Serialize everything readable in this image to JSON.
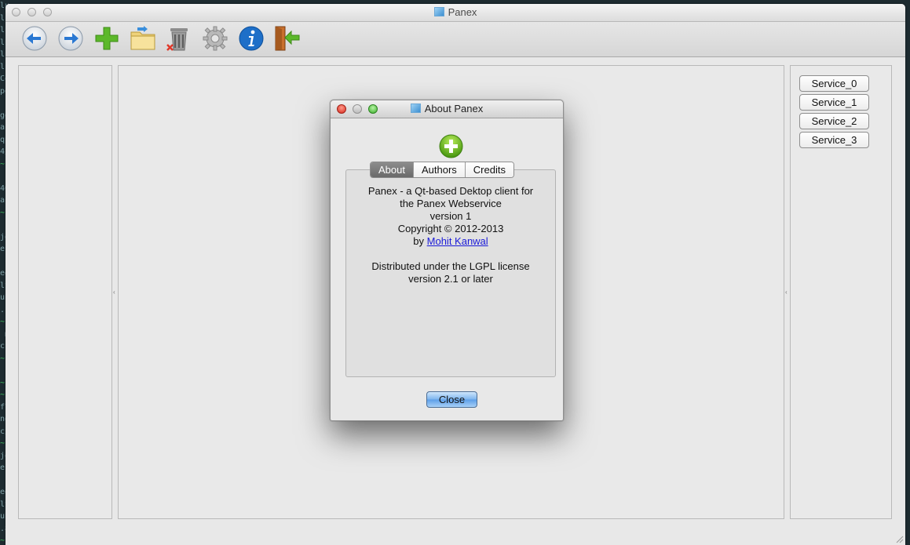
{
  "window": {
    "title": "Panex"
  },
  "toolbar": {
    "buttons": [
      {
        "name": "back-button",
        "icon": "arrow-left-icon"
      },
      {
        "name": "forward-button",
        "icon": "arrow-right-icon"
      },
      {
        "name": "add-button",
        "icon": "plus-icon"
      },
      {
        "name": "open-folder-button",
        "icon": "folder-icon"
      },
      {
        "name": "delete-button",
        "icon": "trash-icon"
      },
      {
        "name": "settings-button",
        "icon": "gear-icon"
      },
      {
        "name": "info-button",
        "icon": "info-icon"
      },
      {
        "name": "exit-button",
        "icon": "exit-door-icon"
      }
    ]
  },
  "services": [
    "Service_0",
    "Service_1",
    "Service_2",
    "Service_3"
  ],
  "dialog": {
    "title": "About Panex",
    "tabs": [
      "About",
      "Authors",
      "Credits"
    ],
    "active_tab": "About",
    "about": {
      "line1": "Panex - a Qt-based Dektop client for",
      "line2": "the Panex Webservice",
      "line3": "version 1",
      "line4": "Copyright © 2012-2013",
      "by_prefix": "by ",
      "author": "Mohit Kanwal",
      "license1": "Distributed under the LGPL license",
      "license2": "version 2.1 or later"
    },
    "close_label": "Close"
  },
  "colors": {
    "accent_blue": "#1e6fc8",
    "green": "#5cb82a",
    "link": "#1a1ad8"
  }
}
